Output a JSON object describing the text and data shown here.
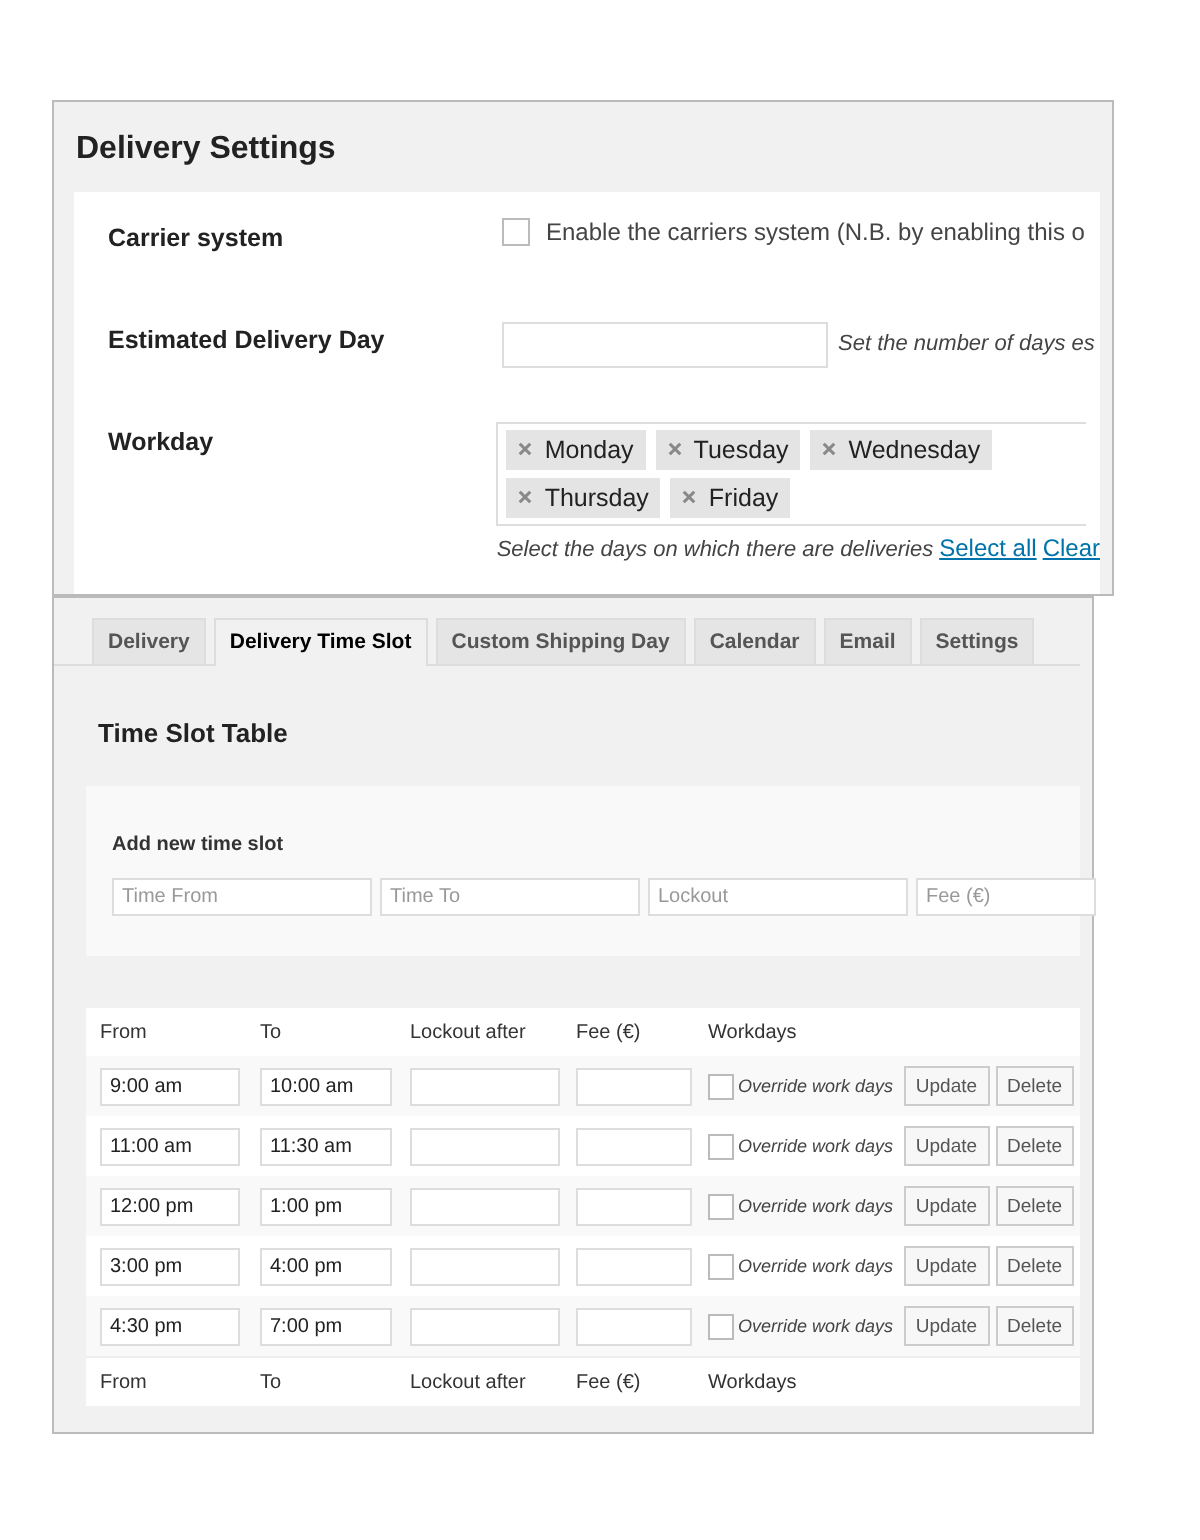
{
  "settings": {
    "title": "Delivery Settings",
    "rows": [
      {
        "kind": "checkbox",
        "label": "Carrier system",
        "checked": false,
        "text": "Enable the carriers system (N.B. by enabling this o"
      },
      {
        "kind": "input",
        "label": "Estimated Delivery Day",
        "hint": "Set the number of days es"
      },
      {
        "kind": "tags",
        "label": "Workday",
        "tags": [
          "Monday",
          "Tuesday",
          "Wednesday",
          "Thursday",
          "Friday"
        ],
        "hint": "Select the days on which there are deliveries",
        "links": [
          "Select all",
          "Clear"
        ]
      }
    ]
  },
  "tabs": [
    {
      "label": "Delivery",
      "selected": false
    },
    {
      "label": "Delivery Time Slot",
      "selected": true
    },
    {
      "label": "Custom Shipping Day",
      "selected": false
    },
    {
      "label": "Calendar",
      "selected": false
    },
    {
      "label": "Email",
      "selected": false
    },
    {
      "label": "Settings",
      "selected": false
    }
  ],
  "section_title": "Time Slot Table",
  "add_form": {
    "title": "Add new time slot",
    "fields": [
      {
        "placeholder": "Time From"
      },
      {
        "placeholder": "Time To"
      },
      {
        "placeholder": "Lockout"
      },
      {
        "placeholder": "Fee (€)"
      }
    ]
  },
  "table": {
    "columns": [
      "From",
      "To",
      "Lockout after",
      "Fee (€)",
      "Workdays"
    ],
    "rows": [
      {
        "from": "9:00 am",
        "to": "10:00 am",
        "override": "Override work days",
        "checked": false,
        "buttons": [
          "Update",
          "Delete"
        ]
      },
      {
        "from": "11:00 am",
        "to": "11:30 am",
        "override": "Override work days",
        "checked": false,
        "buttons": [
          "Update",
          "Delete"
        ]
      },
      {
        "from": "12:00 pm",
        "to": "1:00 pm",
        "override": "Override work days",
        "checked": false,
        "buttons": [
          "Update",
          "Delete"
        ]
      },
      {
        "from": "3:00 pm",
        "to": "4:00 pm",
        "override": "Override work days",
        "checked": false,
        "buttons": [
          "Update",
          "Delete"
        ]
      },
      {
        "from": "4:30 pm",
        "to": "7:00 pm",
        "override": "Override work days",
        "checked": false,
        "buttons": [
          "Update",
          "Delete"
        ]
      }
    ],
    "footer_columns": [
      "From",
      "To",
      "Lockout after",
      "Fee (€)",
      "Workdays"
    ]
  }
}
